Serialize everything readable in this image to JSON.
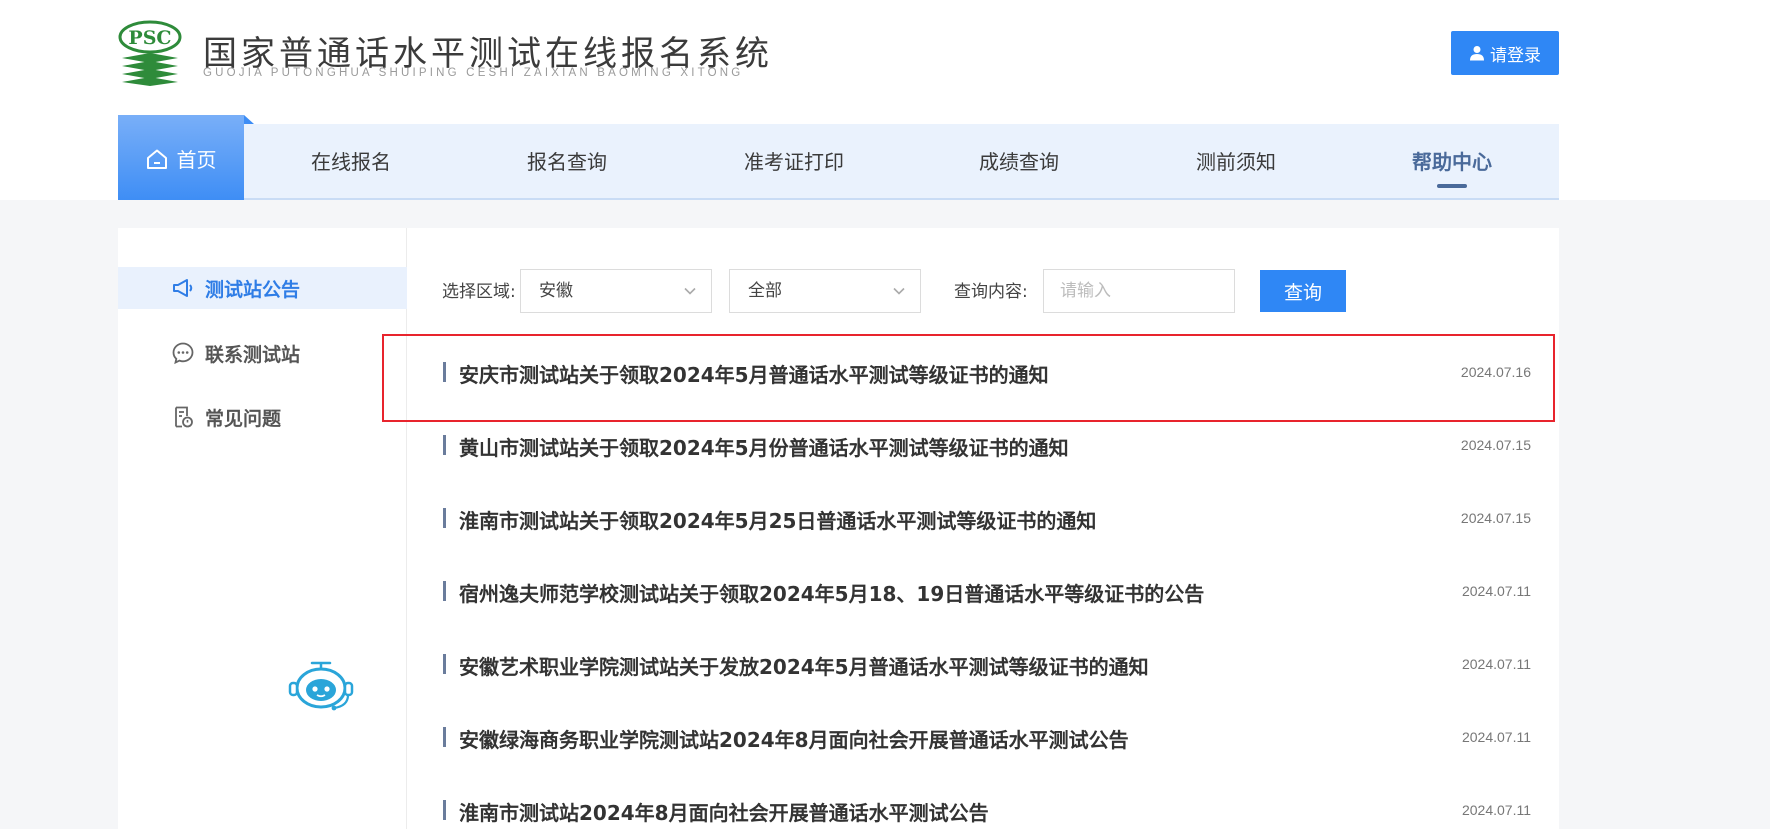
{
  "header": {
    "logo_text": "PSC",
    "title": "国家普通话水平测试在线报名系统",
    "subtitle": "GUOJIA PUTONGHUA SHUIPING CESHI ZAIXIAN BAOMING XITONG",
    "login_label": "请登录"
  },
  "nav": {
    "home": "首页",
    "items": [
      "在线报名",
      "报名查询",
      "准考证打印",
      "成绩查询",
      "测前须知",
      "帮助中心"
    ],
    "active": "帮助中心"
  },
  "sidebar": {
    "items": [
      "测试站公告",
      "联系测试站",
      "常见问题"
    ]
  },
  "filter": {
    "region_label": "选择区域:",
    "region_value": "安徽",
    "scope_value": "全部",
    "query_label": "查询内容:",
    "query_placeholder": "请输入",
    "query_button": "查询"
  },
  "news": [
    {
      "title": "安庆市测试站关于领取2024年5月普通话水平测试等级证书的通知",
      "date": "2024.07.16"
    },
    {
      "title": "黄山市测试站关于领取2024年5月份普通话水平测试等级证书的通知",
      "date": "2024.07.15"
    },
    {
      "title": "淮南市测试站关于领取2024年5月25日普通话水平测试等级证书的通知",
      "date": "2024.07.15"
    },
    {
      "title": "宿州逸夫师范学校测试站关于领取2024年5月18、19日普通话水平等级证书的公告",
      "date": "2024.07.11"
    },
    {
      "title": "安徽艺术职业学院测试站关于发放2024年5月普通话水平测试等级证书的通知",
      "date": "2024.07.11"
    },
    {
      "title": "安徽绿海商务职业学院测试站2024年8月面向社会开展普通话水平测试公告",
      "date": "2024.07.11"
    },
    {
      "title": "淮南市测试站2024年8月面向社会开展普通话水平测试公告",
      "date": "2024.07.11"
    }
  ],
  "colors": {
    "primary": "#2f87f5",
    "nav_bg": "#eaf2fd",
    "highlight": "#e8242d",
    "logo_green": "#2e8b3a"
  }
}
